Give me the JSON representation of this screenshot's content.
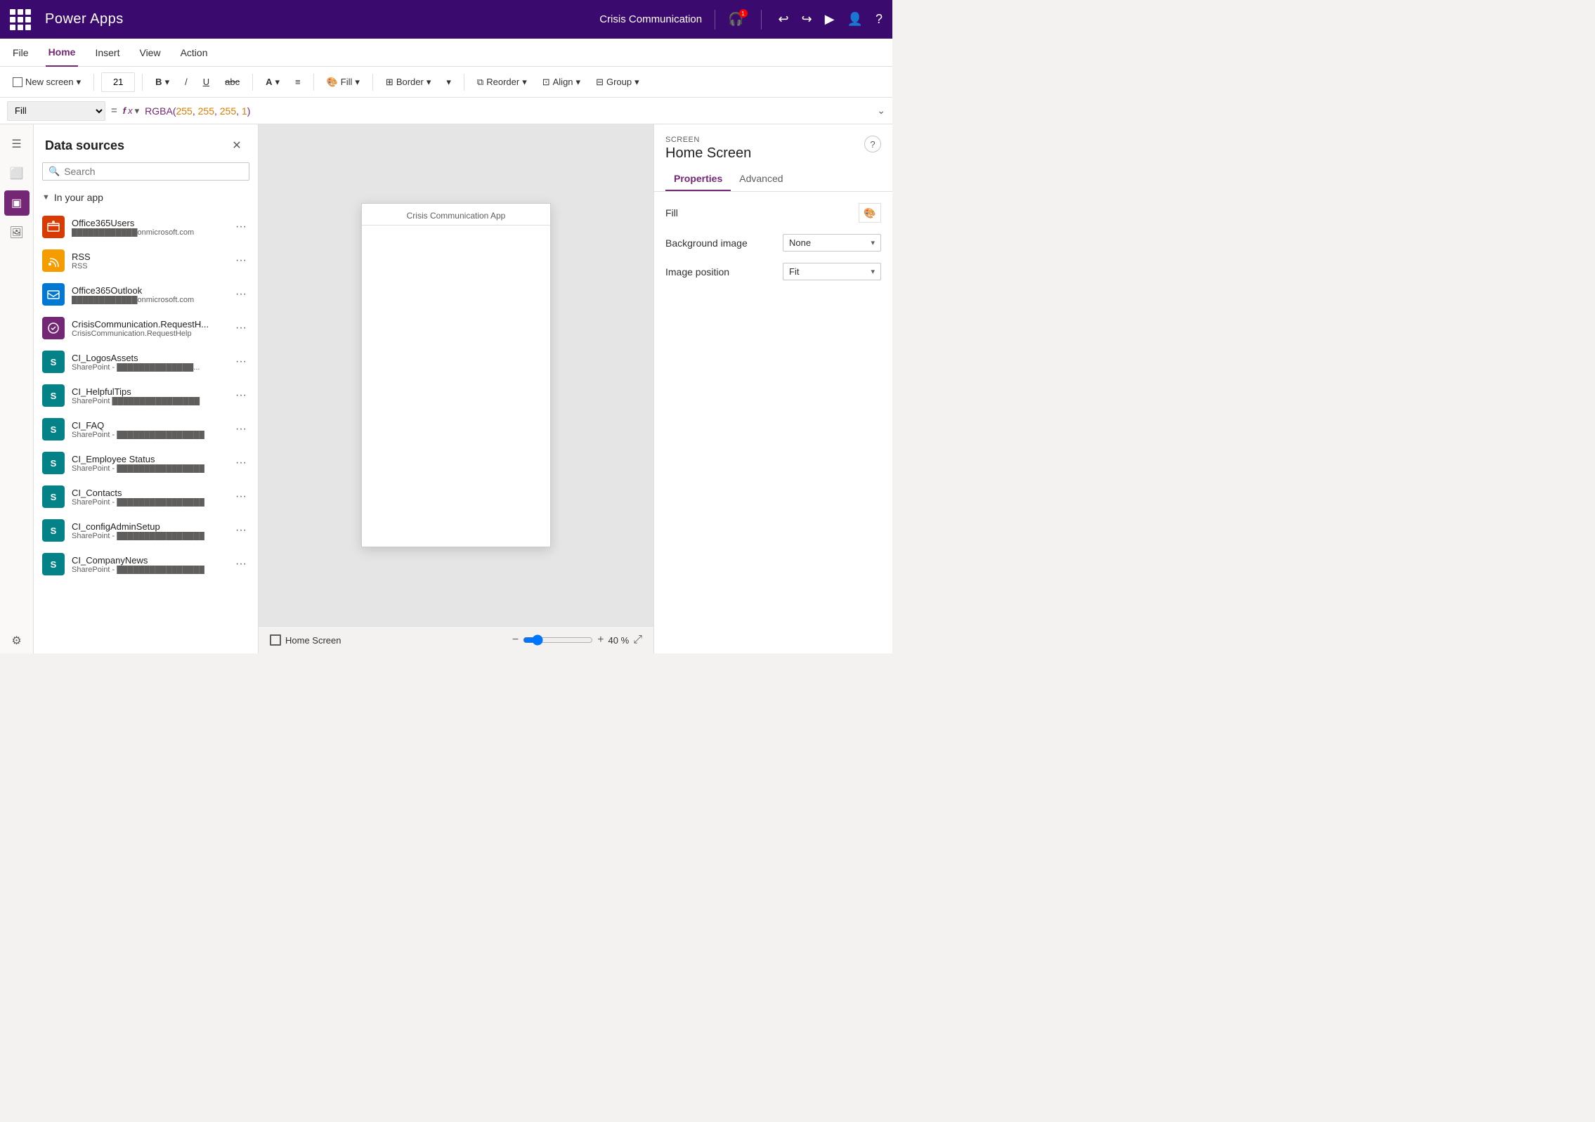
{
  "app": {
    "name": "Power Apps",
    "current_app": "Crisis Communication"
  },
  "topbar": {
    "grid_icon": "grid-icon",
    "title": "Power Apps",
    "app_name": "Crisis Communication",
    "icons": [
      "headset-icon",
      "undo-icon",
      "redo-icon",
      "play-icon",
      "user-icon",
      "help-icon"
    ],
    "notification_count": "1"
  },
  "menubar": {
    "items": [
      {
        "label": "File",
        "active": false
      },
      {
        "label": "Home",
        "active": true
      },
      {
        "label": "Insert",
        "active": false
      },
      {
        "label": "View",
        "active": false
      },
      {
        "label": "Action",
        "active": false
      }
    ]
  },
  "toolbar": {
    "new_screen_label": "New screen",
    "font_size": "21",
    "bold_label": "B",
    "slash_label": "/",
    "underline_label": "U",
    "strikethrough_label": "abc",
    "font_color_label": "A",
    "align_label": "≡",
    "fill_label": "Fill",
    "border_label": "Border",
    "reorder_label": "Reorder",
    "align_menu_label": "Align",
    "group_label": "Group"
  },
  "formulabar": {
    "property": "Fill",
    "formula": "RGBA(255, 255, 255, 1)",
    "formula_parts": {
      "func": "RGBA(",
      "n1": "255",
      "comma1": ", ",
      "n2": "255",
      "comma2": ", ",
      "n3": "255",
      "comma3": ", ",
      "n4": "1",
      "close": ")"
    }
  },
  "datasources_panel": {
    "title": "Data sources",
    "search_placeholder": "Search",
    "section_label": "In your app",
    "items": [
      {
        "name": "Office365Users",
        "sub": "onmicrosoft.com",
        "icon_color": "#d83b01",
        "icon_text": "O",
        "icon_type": "office365"
      },
      {
        "name": "RSS",
        "sub": "RSS",
        "icon_color": "#f59d00",
        "icon_text": "R",
        "icon_type": "rss"
      },
      {
        "name": "Office365Outlook",
        "sub": "onmicrosoft.com",
        "icon_color": "#0078d4",
        "icon_text": "O",
        "icon_type": "outlook"
      },
      {
        "name": "CrisisCommunication.RequestH...",
        "sub": "CrisisCommunication.RequestHelp",
        "icon_color": "#742774",
        "icon_text": "C",
        "icon_type": "custom"
      },
      {
        "name": "CI_LogosAssets",
        "sub": "SharePoint - ██████████████...",
        "icon_color": "#038387",
        "icon_text": "S",
        "icon_type": "sharepoint"
      },
      {
        "name": "CI_HelpfulTips",
        "sub": "SharePoint ████████████████",
        "icon_color": "#038387",
        "icon_text": "S",
        "icon_type": "sharepoint"
      },
      {
        "name": "CI_FAQ",
        "sub": "SharePoint - ████████████████",
        "icon_color": "#038387",
        "icon_text": "S",
        "icon_type": "sharepoint"
      },
      {
        "name": "CI_Employee Status",
        "sub": "SharePoint - ████████████████",
        "icon_color": "#038387",
        "icon_text": "S",
        "icon_type": "sharepoint"
      },
      {
        "name": "CI_Contacts",
        "sub": "SharePoint - ████████████████",
        "icon_color": "#038387",
        "icon_text": "S",
        "icon_type": "sharepoint"
      },
      {
        "name": "CI_configAdminSetup",
        "sub": "SharePoint - ████████████████",
        "icon_color": "#038387",
        "icon_text": "S",
        "icon_type": "sharepoint"
      },
      {
        "name": "CI_CompanyNews",
        "sub": "SharePoint - ████████████████",
        "icon_color": "#038387",
        "icon_text": "S",
        "icon_type": "sharepoint"
      }
    ]
  },
  "canvas": {
    "phone_title": "Crisis Communication App",
    "screen_name": "Home Screen",
    "zoom_value": "40 %",
    "zoom_minus": "−",
    "zoom_plus": "+"
  },
  "properties_panel": {
    "screen_label": "SCREEN",
    "screen_name": "Home Screen",
    "tabs": [
      {
        "label": "Properties",
        "active": true
      },
      {
        "label": "Advanced",
        "active": false
      }
    ],
    "fill_label": "Fill",
    "background_image_label": "Background image",
    "background_image_value": "None",
    "image_position_label": "Image position",
    "image_position_value": "Fit"
  }
}
